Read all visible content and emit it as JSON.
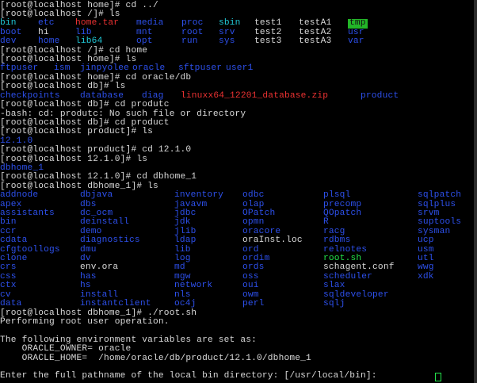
{
  "window": {
    "title": ""
  },
  "colors": {
    "bg": "#000000",
    "fg": "#d9d9d9",
    "dir": "#2d50ec",
    "link": "#20c7d6",
    "exec": "#23e34a",
    "archive": "#ee3232",
    "cursor": "#23e34a",
    "tmp_fg": "#111111",
    "tmp_bg": "#23b528"
  },
  "terminal": {
    "lines": [
      {
        "segs": [
          {
            "t": "[root@localhost home]# cd ../",
            "c": "fg"
          }
        ]
      },
      {
        "segs": [
          {
            "t": "[root@localhost /]# ls",
            "c": "fg"
          }
        ]
      },
      {
        "cols": [
          0,
          48,
          95,
          172,
          229,
          276,
          331,
          389
        ],
        "segs": [
          {
            "t": "bin",
            "c": "link"
          },
          {
            "t": "etc",
            "c": "dir"
          },
          {
            "t": "home.tar",
            "c": "archive"
          },
          {
            "t": "media",
            "c": "dir"
          },
          {
            "t": "proc",
            "c": "dir"
          },
          {
            "t": "sbin",
            "c": "link"
          },
          {
            "t": "test1",
            "c": "fg"
          },
          {
            "t": "testA1",
            "c": "fg"
          },
          {
            "t": "tmp",
            "c": "tmp"
          }
        ],
        "colsFull": [
          0,
          48,
          95,
          172,
          229,
          276,
          321,
          377,
          439
        ]
      },
      {
        "colsFull": [
          0,
          48,
          95,
          172,
          229,
          276,
          321,
          377,
          439
        ],
        "segs": [
          {
            "t": "boot",
            "c": "dir"
          },
          {
            "t": "hi",
            "c": "fg"
          },
          {
            "t": "lib",
            "c": "dir"
          },
          {
            "t": "mnt",
            "c": "dir"
          },
          {
            "t": "root",
            "c": "dir"
          },
          {
            "t": "srv",
            "c": "dir"
          },
          {
            "t": "test2",
            "c": "fg"
          },
          {
            "t": "testA2",
            "c": "fg"
          },
          {
            "t": "usr",
            "c": "dir"
          }
        ]
      },
      {
        "colsFull": [
          0,
          48,
          95,
          172,
          229,
          276,
          321,
          377,
          439
        ],
        "segs": [
          {
            "t": "dev",
            "c": "dir"
          },
          {
            "t": "home",
            "c": "dir"
          },
          {
            "t": "lib64",
            "c": "link"
          },
          {
            "t": "opt",
            "c": "dir"
          },
          {
            "t": "run",
            "c": "dir"
          },
          {
            "t": "sys",
            "c": "dir"
          },
          {
            "t": "test3",
            "c": "fg"
          },
          {
            "t": "testA3",
            "c": "fg"
          },
          {
            "t": "var",
            "c": "dir"
          }
        ]
      },
      {
        "segs": [
          {
            "t": "[root@localhost /]# cd home",
            "c": "fg"
          }
        ]
      },
      {
        "segs": [
          {
            "t": "[root@localhost home]# ls",
            "c": "fg"
          }
        ]
      },
      {
        "colsFull": [
          0,
          68,
          101,
          167,
          225,
          285
        ],
        "segs": [
          {
            "t": "ftpuser",
            "c": "dir"
          },
          {
            "t": "ism",
            "c": "dir"
          },
          {
            "t": "jinpyolee",
            "c": "dir"
          },
          {
            "t": "oracle",
            "c": "dir"
          },
          {
            "t": "sftpuser",
            "c": "dir"
          },
          {
            "t": "user1",
            "c": "dir"
          }
        ]
      },
      {
        "segs": [
          {
            "t": "[root@localhost home]# cd oracle/db",
            "c": "fg"
          }
        ]
      },
      {
        "segs": [
          {
            "t": "[root@localhost db]# ls",
            "c": "fg"
          }
        ]
      },
      {
        "colsFull": [
          0,
          101,
          179,
          228,
          455
        ],
        "segs": [
          {
            "t": "checkpoints",
            "c": "dir"
          },
          {
            "t": "database",
            "c": "dir"
          },
          {
            "t": "diag",
            "c": "dir"
          },
          {
            "t": "linuxx64_12201_database.zip",
            "c": "archive"
          },
          {
            "t": "product",
            "c": "dir"
          }
        ]
      },
      {
        "segs": [
          {
            "t": "[root@localhost db]# cd produtc",
            "c": "fg"
          }
        ]
      },
      {
        "segs": [
          {
            "t": "-bash: cd: produtc: No such file or directory",
            "c": "fg"
          }
        ]
      },
      {
        "segs": [
          {
            "t": "[root@localhost db]# cd product",
            "c": "fg"
          }
        ]
      },
      {
        "segs": [
          {
            "t": "[root@localhost product]# ls",
            "c": "fg"
          }
        ]
      },
      {
        "segs": [
          {
            "t": "12.1.0",
            "c": "dir"
          }
        ]
      },
      {
        "segs": [
          {
            "t": "[root@localhost product]# cd 12.1.0",
            "c": "fg"
          }
        ]
      },
      {
        "segs": [
          {
            "t": "[root@localhost 12.1.0]# ls",
            "c": "fg"
          }
        ]
      },
      {
        "segs": [
          {
            "t": "dbhome_1",
            "c": "dir"
          }
        ]
      },
      {
        "segs": [
          {
            "t": "[root@localhost 12.1.0]# cd dbhome_1",
            "c": "fg"
          }
        ]
      },
      {
        "segs": [
          {
            "t": "[root@localhost dbhome_1]# ls",
            "c": "fg"
          }
        ]
      },
      {
        "colsFull": [
          0,
          101,
          220,
          306,
          408,
          527
        ],
        "segs": [
          {
            "t": "addnode",
            "c": "dir"
          },
          {
            "t": "dbjava",
            "c": "dir"
          },
          {
            "t": "inventory",
            "c": "dir"
          },
          {
            "t": "odbc",
            "c": "dir"
          },
          {
            "t": "plsql",
            "c": "dir"
          },
          {
            "t": "sqlpatch",
            "c": "dir"
          }
        ]
      },
      {
        "colsFull": [
          0,
          101,
          220,
          306,
          408,
          527
        ],
        "segs": [
          {
            "t": "apex",
            "c": "dir"
          },
          {
            "t": "dbs",
            "c": "dir"
          },
          {
            "t": "javavm",
            "c": "dir"
          },
          {
            "t": "olap",
            "c": "dir"
          },
          {
            "t": "precomp",
            "c": "dir"
          },
          {
            "t": "sqlplus",
            "c": "dir"
          }
        ]
      },
      {
        "colsFull": [
          0,
          101,
          220,
          306,
          408,
          527
        ],
        "segs": [
          {
            "t": "assistants",
            "c": "dir"
          },
          {
            "t": "dc_ocm",
            "c": "dir"
          },
          {
            "t": "jdbc",
            "c": "dir"
          },
          {
            "t": "OPatch",
            "c": "dir"
          },
          {
            "t": "QOpatch",
            "c": "dir"
          },
          {
            "t": "srvm",
            "c": "dir"
          }
        ]
      },
      {
        "colsFull": [
          0,
          101,
          220,
          306,
          408,
          527
        ],
        "segs": [
          {
            "t": "bin",
            "c": "dir"
          },
          {
            "t": "deinstall",
            "c": "dir"
          },
          {
            "t": "jdk",
            "c": "dir"
          },
          {
            "t": "opmn",
            "c": "dir"
          },
          {
            "t": "R",
            "c": "dir"
          },
          {
            "t": "suptools",
            "c": "dir"
          }
        ]
      },
      {
        "colsFull": [
          0,
          101,
          220,
          306,
          408,
          527
        ],
        "segs": [
          {
            "t": "ccr",
            "c": "dir"
          },
          {
            "t": "demo",
            "c": "dir"
          },
          {
            "t": "jlib",
            "c": "dir"
          },
          {
            "t": "oracore",
            "c": "dir"
          },
          {
            "t": "racg",
            "c": "dir"
          },
          {
            "t": "sysman",
            "c": "dir"
          }
        ]
      },
      {
        "colsFull": [
          0,
          101,
          220,
          306,
          408,
          527
        ],
        "segs": [
          {
            "t": "cdata",
            "c": "dir"
          },
          {
            "t": "diagnostics",
            "c": "dir"
          },
          {
            "t": "ldap",
            "c": "dir"
          },
          {
            "t": "oraInst.loc",
            "c": "fg"
          },
          {
            "t": "rdbms",
            "c": "dir"
          },
          {
            "t": "ucp",
            "c": "dir"
          }
        ]
      },
      {
        "colsFull": [
          0,
          101,
          220,
          306,
          408,
          527
        ],
        "segs": [
          {
            "t": "cfgtoollogs",
            "c": "dir"
          },
          {
            "t": "dmu",
            "c": "dir"
          },
          {
            "t": "lib",
            "c": "dir"
          },
          {
            "t": "ord",
            "c": "dir"
          },
          {
            "t": "relnotes",
            "c": "dir"
          },
          {
            "t": "usm",
            "c": "dir"
          }
        ]
      },
      {
        "colsFull": [
          0,
          101,
          220,
          306,
          408,
          527
        ],
        "segs": [
          {
            "t": "clone",
            "c": "dir"
          },
          {
            "t": "dv",
            "c": "dir"
          },
          {
            "t": "log",
            "c": "dir"
          },
          {
            "t": "ordim",
            "c": "dir"
          },
          {
            "t": "root.sh",
            "c": "exec"
          },
          {
            "t": "utl",
            "c": "dir"
          }
        ]
      },
      {
        "colsFull": [
          0,
          101,
          220,
          306,
          408,
          527
        ],
        "segs": [
          {
            "t": "crs",
            "c": "dir"
          },
          {
            "t": "env.ora",
            "c": "fg"
          },
          {
            "t": "md",
            "c": "dir"
          },
          {
            "t": "ords",
            "c": "dir"
          },
          {
            "t": "schagent.conf",
            "c": "fg"
          },
          {
            "t": "wwg",
            "c": "dir"
          }
        ]
      },
      {
        "colsFull": [
          0,
          101,
          220,
          306,
          408,
          527
        ],
        "segs": [
          {
            "t": "css",
            "c": "dir"
          },
          {
            "t": "has",
            "c": "dir"
          },
          {
            "t": "mgw",
            "c": "dir"
          },
          {
            "t": "oss",
            "c": "dir"
          },
          {
            "t": "scheduler",
            "c": "dir"
          },
          {
            "t": "xdk",
            "c": "dir"
          }
        ]
      },
      {
        "colsFull": [
          0,
          101,
          220,
          306,
          408
        ],
        "segs": [
          {
            "t": "ctx",
            "c": "dir"
          },
          {
            "t": "hs",
            "c": "dir"
          },
          {
            "t": "network",
            "c": "dir"
          },
          {
            "t": "oui",
            "c": "dir"
          },
          {
            "t": "slax",
            "c": "dir"
          }
        ]
      },
      {
        "colsFull": [
          0,
          101,
          220,
          306,
          408
        ],
        "segs": [
          {
            "t": "cv",
            "c": "dir"
          },
          {
            "t": "install",
            "c": "dir"
          },
          {
            "t": "nls",
            "c": "dir"
          },
          {
            "t": "owm",
            "c": "dir"
          },
          {
            "t": "sqldeveloper",
            "c": "dir"
          }
        ]
      },
      {
        "colsFull": [
          0,
          101,
          220,
          306,
          408
        ],
        "segs": [
          {
            "t": "data",
            "c": "dir"
          },
          {
            "t": "instantclient",
            "c": "dir"
          },
          {
            "t": "oc4j",
            "c": "dir"
          },
          {
            "t": "perl",
            "c": "dir"
          },
          {
            "t": "sqlj",
            "c": "dir"
          }
        ]
      },
      {
        "segs": [
          {
            "t": "[root@localhost dbhome_1]# ./root.sh",
            "c": "fg"
          }
        ]
      },
      {
        "segs": [
          {
            "t": "Performing root user operation.",
            "c": "fg"
          }
        ]
      },
      {
        "segs": [
          {
            "t": "",
            "c": "fg"
          }
        ]
      },
      {
        "segs": [
          {
            "t": "The following environment variables are set as:",
            "c": "fg"
          }
        ]
      },
      {
        "segs": [
          {
            "t": "    ORACLE_OWNER= oracle",
            "c": "fg"
          }
        ]
      },
      {
        "segs": [
          {
            "t": "    ORACLE_HOME=  /home/oracle/db/product/12.1.0/dbhome_1",
            "c": "fg"
          }
        ]
      },
      {
        "segs": [
          {
            "t": "",
            "c": "fg"
          }
        ]
      },
      {
        "segs": [
          {
            "t": "Enter the full pathname of the local bin directory: [/usr/local/bin]: ",
            "c": "fg"
          }
        ],
        "cursor": true
      }
    ]
  }
}
